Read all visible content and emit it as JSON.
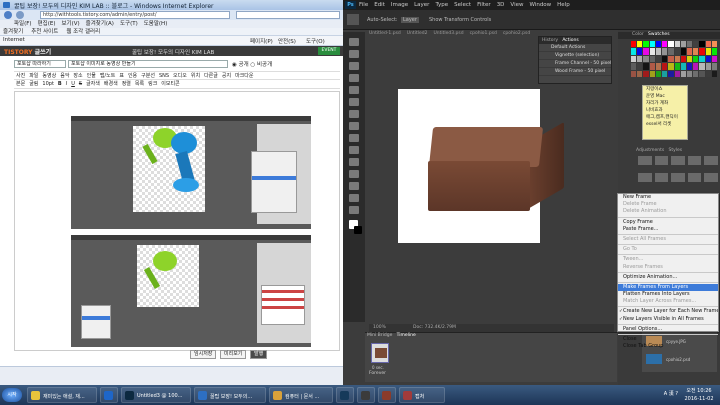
{
  "ie": {
    "title": "꿀팁 보장! 모두의 디자인 KIM LAB :: 블로그 - Windows Internet Explorer",
    "address": "http://withtools.tistory.com/admin/entry/post/",
    "menu": [
      "파일(F)",
      "편집(E)",
      "보기(V)",
      "즐겨찾기(A)",
      "도구(T)",
      "도움말(H)"
    ],
    "favorites": [
      "즐겨찾기",
      "추천 사이트",
      "웹 조각 갤러리"
    ],
    "command": {
      "left": "Internet",
      "items": [
        "페이지(P)",
        "안전(S)",
        "도구(O)"
      ]
    },
    "tistory_logo": "TISTORY",
    "tistory_sub": "글쓰기",
    "blog_name": "꿀팁 보장! 모두의 디자인 KIM LAB",
    "event_badge": "EVENT",
    "category": "포토샵 따라하기",
    "post_title": "포토샵 이미지로 동영상 만들기",
    "visibility": [
      "공개",
      "비공개"
    ],
    "toolbar1": [
      "사진",
      "파일",
      "동영상",
      "음악",
      "장소",
      "인물",
      "맵/노트",
      "표",
      "인용",
      "구분선",
      "SNS",
      "오디오",
      "위치",
      "다른글",
      "공지",
      "마크다운"
    ],
    "toolbar2": [
      "본문",
      "굴림",
      "10pt",
      "B",
      "I",
      "U",
      "S",
      "글자색",
      "배경색",
      "정렬",
      "목록",
      "링크",
      "이모티콘"
    ],
    "buttons": [
      "임시저장",
      "미리보기",
      "발행"
    ]
  },
  "ps": {
    "logo": "Ps",
    "menu": [
      "File",
      "Edit",
      "Image",
      "Layer",
      "Type",
      "Select",
      "Filter",
      "3D",
      "View",
      "Window",
      "Help"
    ],
    "options": [
      "Auto-Select:",
      "Layer",
      "Show Transform Controls"
    ],
    "tabs": [
      "Untitled-1.psd",
      "Untitled2",
      "Untitled3.psd",
      "cpohio1.psd",
      "cpohio2.psd"
    ],
    "actions_header": [
      "History",
      "Actions"
    ],
    "actions": [
      "Default Actions",
      "Vignette (selection)",
      "Frame Channel - 50 pixel",
      "Wood Frame - 50 pixel"
    ],
    "status_zoom": "100%",
    "status_doc": "Doc: 732.4K/2.79M",
    "timeline_tabs": [
      "Mini Bridge",
      "Timeline"
    ],
    "frame_delay": "0 sec.",
    "loop": "Forever",
    "swatches_header": [
      "Color",
      "Swatches"
    ],
    "notes": [
      "지렁이쇼",
      "운영 Mac",
      "자리가 계좌",
      "나비효과",
      "애그,캠프,캔딕이",
      "essel서 리셋"
    ],
    "adjust_header": [
      "Adjustments",
      "Styles"
    ],
    "layer_thumbs": [
      "cpyye.JPG",
      "cpohio2.psd"
    ]
  },
  "context_menu": [
    {
      "label": "New Frame",
      "state": "normal"
    },
    {
      "label": "Delete Frame",
      "state": "disabled"
    },
    {
      "label": "Delete Animation",
      "state": "disabled"
    },
    {
      "label": "",
      "state": "sep"
    },
    {
      "label": "Copy Frame",
      "state": "normal"
    },
    {
      "label": "Paste Frame...",
      "state": "normal"
    },
    {
      "label": "",
      "state": "sep"
    },
    {
      "label": "Select All Frames",
      "state": "disabled"
    },
    {
      "label": "",
      "state": "sep"
    },
    {
      "label": "Go To",
      "state": "disabled"
    },
    {
      "label": "",
      "state": "sep"
    },
    {
      "label": "Tween...",
      "state": "disabled"
    },
    {
      "label": "Reverse Frames",
      "state": "disabled"
    },
    {
      "label": "",
      "state": "sep"
    },
    {
      "label": "Optimize Animation...",
      "state": "normal"
    },
    {
      "label": "",
      "state": "sep"
    },
    {
      "label": "Make Frames From Layers",
      "state": "highlight"
    },
    {
      "label": "Flatten Frames Into Layers",
      "state": "normal"
    },
    {
      "label": "Match Layer Across Frames...",
      "state": "disabled"
    },
    {
      "label": "",
      "state": "sep"
    },
    {
      "label": "Create New Layer for Each New Frame",
      "state": "checked"
    },
    {
      "label": "New Layers Visible in All Frames",
      "state": "checked"
    },
    {
      "label": "",
      "state": "sep"
    },
    {
      "label": "Panel Options...",
      "state": "normal"
    },
    {
      "label": "",
      "state": "sep"
    },
    {
      "label": "Close",
      "state": "normal"
    },
    {
      "label": "Close Tab Group",
      "state": "normal"
    }
  ],
  "taskbar": {
    "start": "시작",
    "items": [
      {
        "label": "재미있는 애설, 재...",
        "color": "#e8c33b"
      },
      {
        "label": "",
        "color": "#1e66c9"
      },
      {
        "label": "Untitled3 @ 100...",
        "color": "#0c2940"
      },
      {
        "label": "꿀팁 보장! 모두의...",
        "color": "#2d6fc2"
      },
      {
        "label": "컴퓨터 | 문서 ...",
        "color": "#d9a13a"
      },
      {
        "label": "",
        "color": "#163a5a"
      },
      {
        "label": "",
        "color": "#3b3b3b"
      },
      {
        "label": "",
        "color": "#8a3b2a"
      },
      {
        "label": "캡처",
        "color": "#a23b3b"
      }
    ],
    "tray": "A 漢 ?",
    "time": "오전 10:26",
    "date": "2016-11-02"
  }
}
